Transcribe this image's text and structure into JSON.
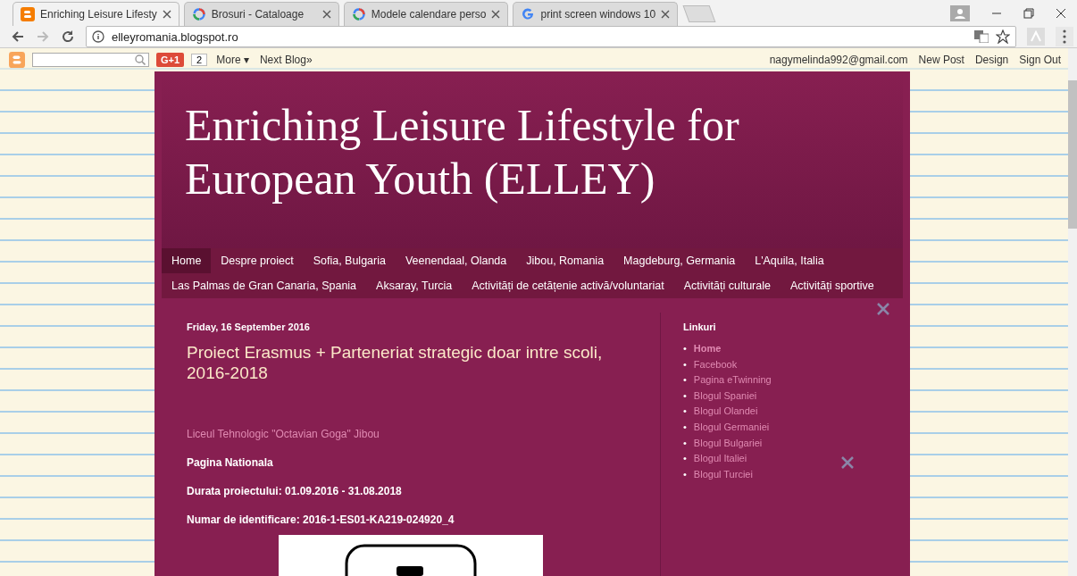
{
  "browser": {
    "tabs": [
      {
        "title": "Enriching Leisure Lifesty",
        "selected": true
      },
      {
        "title": "Brosuri - Cataloage",
        "selected": false
      },
      {
        "title": "Modele calendare perso",
        "selected": false
      },
      {
        "title": "print screen windows 10",
        "selected": false
      }
    ],
    "url": "elleyromania.blogspot.ro"
  },
  "navbar": {
    "gplus": "G+1",
    "count": "2",
    "more": "More ▾",
    "next_blog": "Next Blog»",
    "email": "nagymelinda992@gmail.com",
    "links": [
      "New Post",
      "Design",
      "Sign Out"
    ]
  },
  "blog": {
    "title": "Enriching Leisure Lifestyle for European Youth (ELLEY)",
    "nav": [
      {
        "label": "Home",
        "selected": true
      },
      {
        "label": "Despre proiect",
        "selected": false
      },
      {
        "label": "Sofia, Bulgaria",
        "selected": false
      },
      {
        "label": "Veenendaal, Olanda",
        "selected": false
      },
      {
        "label": "Jibou, Romania",
        "selected": false
      },
      {
        "label": "Magdeburg, Germania",
        "selected": false
      },
      {
        "label": "L'Aquila, Italia",
        "selected": false
      },
      {
        "label": "Las Palmas de Gran Canaria, Spania",
        "selected": false
      },
      {
        "label": "Aksaray, Turcia",
        "selected": false
      },
      {
        "label": "Activități de cetățenie activă/voluntariat",
        "selected": false
      },
      {
        "label": "Activități culturale",
        "selected": false
      },
      {
        "label": "Activități sportive",
        "selected": false
      }
    ],
    "post": {
      "date": "Friday, 16 September 2016",
      "title": "Proiect Erasmus + Parteneriat strategic doar intre scoli, 2016-2018",
      "paragraphs": [
        {
          "kind": "link",
          "text": "Liceul Tehnologic \"Octavian Goga\" Jibou"
        },
        {
          "kind": "bold",
          "text": "Pagina Nationala"
        },
        {
          "kind": "plain",
          "text": "Durata proiectului: 01.09.2016 - 31.08.2018"
        },
        {
          "kind": "plain",
          "text": "Numar de identificare:  2016-1-ES01-KA219-024920_4"
        }
      ]
    },
    "sidebar": {
      "title": "Linkuri",
      "links": [
        {
          "bullet": "•",
          "label": "Home",
          "selected": true
        },
        {
          "bullet": "•",
          "label": "Facebook",
          "selected": false
        },
        {
          "bullet": "•",
          "label": "Pagina eTwinning",
          "selected": false
        },
        {
          "bullet": "•",
          "label": "Blogul Spaniei",
          "selected": false
        },
        {
          "bullet": "•",
          "label": "Blogul Olandei",
          "selected": false
        },
        {
          "bullet": "•",
          "label": "Blogul Germaniei",
          "selected": false
        },
        {
          "bullet": "•",
          "label": "Blogul Bulgariei",
          "selected": false
        },
        {
          "bullet": "•",
          "label": "Blogul Italiei",
          "selected": false
        },
        {
          "bullet": "•",
          "label": "Blogul Turciei",
          "selected": false
        }
      ]
    }
  }
}
